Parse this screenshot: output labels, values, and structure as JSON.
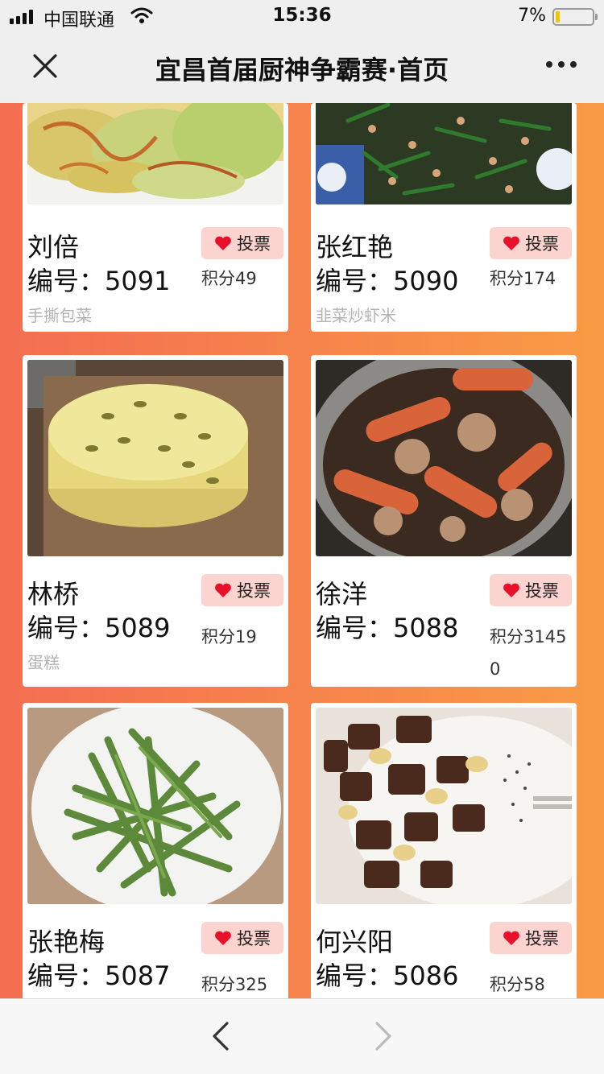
{
  "status": {
    "carrier": "中国联通",
    "time": "15:36",
    "battery": "7%"
  },
  "nav": {
    "title": "宜昌首届厨神争霸赛·首页"
  },
  "vote_label": "投票",
  "number_prefix": "编号：",
  "score_prefix": "积分",
  "entries": [
    {
      "name": "刘倍",
      "number": "5091",
      "score": "49",
      "dish": "手撕包菜"
    },
    {
      "name": "张红艳",
      "number": "5090",
      "score": "174",
      "dish": "韭菜炒虾米"
    },
    {
      "name": "林桥",
      "number": "5089",
      "score": "19",
      "dish": "蛋糕"
    },
    {
      "name": "徐洋",
      "number": "5088",
      "score": "31450",
      "dish": ""
    },
    {
      "name": "张艳梅",
      "number": "5087",
      "score": "325",
      "dish": ""
    },
    {
      "name": "何兴阳",
      "number": "5086",
      "score": "58",
      "dish": ""
    }
  ],
  "colors": {
    "background_start": "#f46e52",
    "background_end": "#f99b45",
    "vote_bg": "#fbd3cf",
    "heart": "#e8102a"
  },
  "icons": [
    "signal-icon",
    "wifi-icon",
    "battery-icon",
    "close-icon",
    "more-icon",
    "heart-icon",
    "back-arrow-icon",
    "forward-arrow-icon"
  ]
}
